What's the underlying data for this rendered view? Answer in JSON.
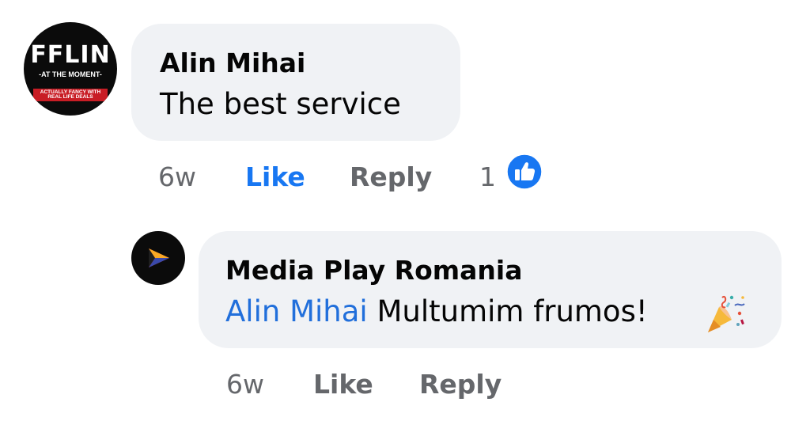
{
  "comment": {
    "avatar": {
      "logo_text": "FFLIN",
      "logo_subtitle": "-AT THE MOMENT-",
      "logo_band": "ACTUALLY FANCY WITH\nREAL LIFE DEALS",
      "band_color": "#c81d25"
    },
    "author": "Alin Mihai",
    "text": "The best service",
    "age": "6w",
    "like_label": "Like",
    "reply_label": "Reply",
    "reaction_count": "1",
    "reaction_icon": "thumbs-up-icon",
    "like_color": "#1877f2"
  },
  "reply": {
    "avatar_icon": "play-triangle-logo",
    "author": "Media Play Romania",
    "mention": "Alin Mihai",
    "text": "Multumim frumos!",
    "emoji": "party-popper-icon",
    "age": "6w",
    "like_label": "Like",
    "reply_label": "Reply",
    "mention_color": "#216fdb"
  },
  "colors": {
    "bubble": "#f0f2f5",
    "secondary_text": "#65676b",
    "primary_text": "#050505"
  }
}
